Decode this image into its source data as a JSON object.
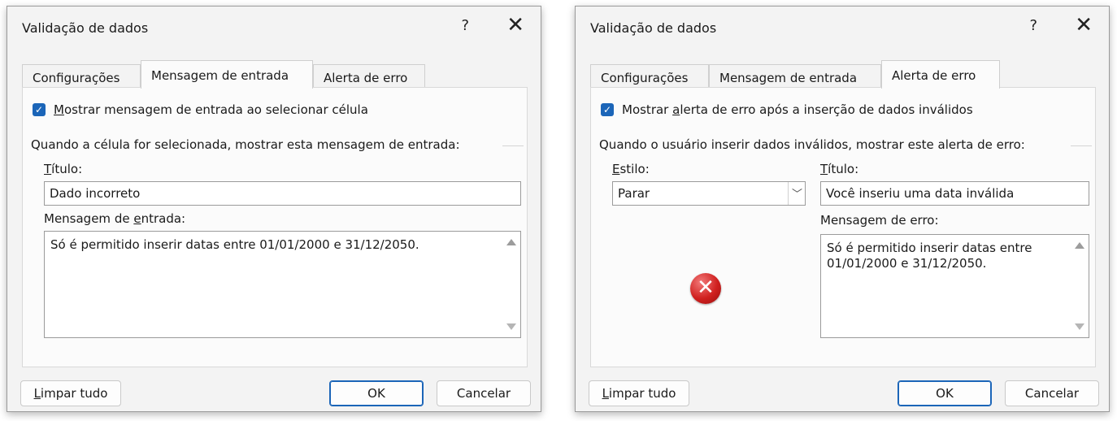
{
  "dialog1": {
    "title": "Validação de dados",
    "help_icon": "?",
    "close_icon": "✕",
    "tabs": [
      "Configurações",
      "Mensagem de entrada",
      "Alerta de erro"
    ],
    "active_tab": "Mensagem de entrada",
    "checkbox": {
      "checked": true,
      "label_first": "M",
      "label_rest": "ostrar mensagem de entrada ao selecionar célula"
    },
    "section_label": "Quando a célula for selecionada, mostrar esta mensagem de entrada:",
    "title_label_first": "T",
    "title_label_rest": "ítulo:",
    "title_value": "Dado incorreto",
    "message_label_pre": "Mensagem de ",
    "message_label_u": "e",
    "message_label_post": "ntrada:",
    "message_value": "Só é permitido inserir datas entre 01/01/2000 e 31/12/2050.",
    "clear_first": "L",
    "clear_rest": "impar tudo",
    "ok": "OK",
    "cancel": "Cancelar"
  },
  "dialog2": {
    "title": "Validação de dados",
    "help_icon": "?",
    "close_icon": "✕",
    "tabs": [
      "Configurações",
      "Mensagem de entrada",
      "Alerta de erro"
    ],
    "active_tab": "Alerta de erro",
    "checkbox": {
      "checked": true,
      "label_pre": "Mostrar ",
      "label_u": "a",
      "label_post": "lerta de erro após a inserção de dados inválidos"
    },
    "section_label": "Quando o usuário inserir dados inválidos, mostrar este alerta de erro:",
    "style_label_first": "E",
    "style_label_rest": "stilo:",
    "style_value": "Parar",
    "title_label_first": "T",
    "title_label_rest": "ítulo:",
    "title_value": "Você inseriu uma data inválida",
    "message_label": "Mensagem de erro:",
    "message_value": "Só é permitido inserir datas entre 01/01/2000 e 31/12/2050.",
    "error_icon": "error-stop-icon",
    "clear_first": "L",
    "clear_rest": "impar tudo",
    "ok": "OK",
    "cancel": "Cancelar"
  },
  "colors": {
    "accent": "#1b65b8",
    "error": "#d0201f",
    "dialog_bg": "#f3f3f3"
  }
}
